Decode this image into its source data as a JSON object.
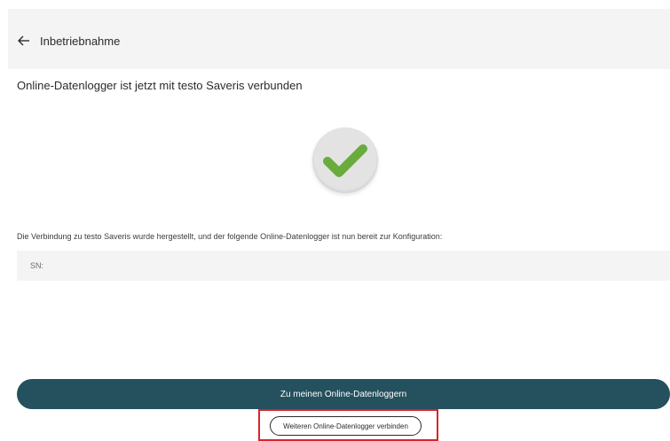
{
  "header": {
    "back_icon": "arrow-left-icon",
    "title": "Inbetriebnahme"
  },
  "main": {
    "headline": "Online-Datenlogger ist jetzt mit testo Saveris verbunden",
    "success_icon": "checkmark-icon",
    "info_text": "Die Verbindung zu testo Saveris wurde hergestellt, und der folgende Online-Datenlogger ist nun bereit zur Konfiguration:",
    "sn_label": "SN:"
  },
  "actions": {
    "primary_label": "Zu meinen Online-Datenloggern",
    "secondary_label": "Weiteren Online-Datenlogger verbinden"
  },
  "colors": {
    "primary_button": "#24515d",
    "check_green": "#6aab3d",
    "highlight_border": "#d9242d"
  }
}
